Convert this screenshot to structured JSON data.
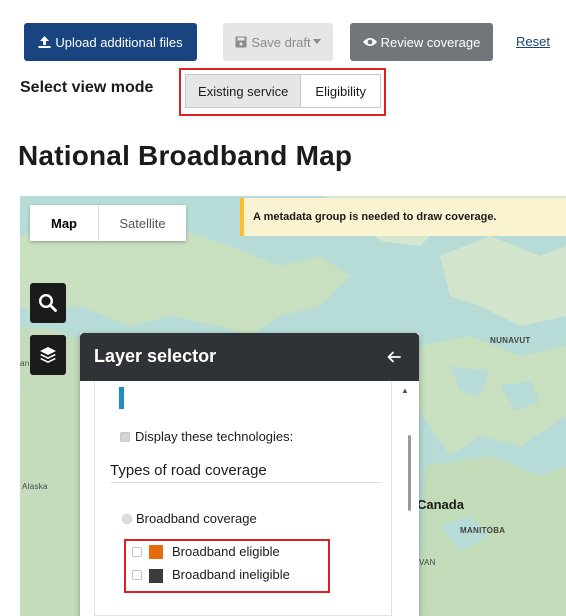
{
  "toolbar": {
    "upload_label": "Upload additional files",
    "save_draft_label": "Save draft",
    "review_label": "Review coverage",
    "reset_label": "Reset"
  },
  "view_mode": {
    "label": "Select view mode",
    "options": [
      "Existing service",
      "Eligibility"
    ],
    "selected": "Eligibility"
  },
  "page_title": "National Broadband Map",
  "map": {
    "type_options": [
      "Map",
      "Satellite"
    ],
    "selected_type": "Map",
    "warning": "A metadata group is needed to draw coverage.",
    "labels": {
      "canada": "Canada",
      "nunavut": "NUNAVUT",
      "manitoba": "MANITOBA",
      "alaska": "Alaska",
      "van": "VAN",
      "left_edge": "an"
    }
  },
  "layer_selector": {
    "title": "Layer selector",
    "display_technologies": "Display these technologies:",
    "types_heading": "Types of road coverage",
    "broadband_coverage": "Broadband coverage",
    "legend": [
      {
        "label": "Broadband eligible",
        "color": "#e66c0a"
      },
      {
        "label": "Broadband ineligible",
        "color": "#3a3a3a"
      }
    ]
  },
  "colors": {
    "primary": "#1a4480",
    "highlight": "#e02020",
    "warning_bg": "#faf3d1",
    "warning_border": "#ffbe2e",
    "panel_header": "#2f3337"
  }
}
